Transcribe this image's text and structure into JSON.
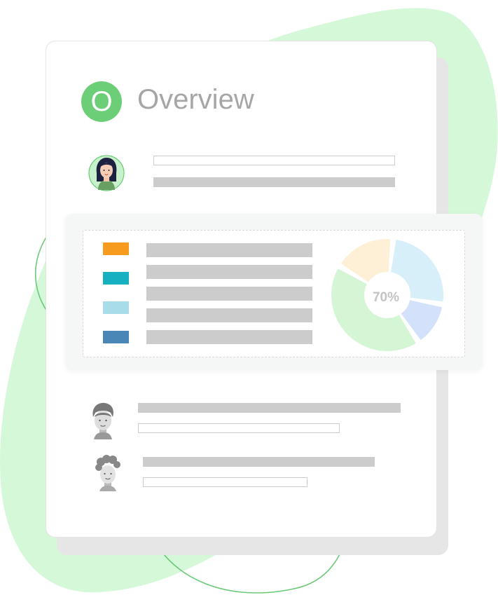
{
  "header": {
    "logo_letter": "O",
    "title": "Overview"
  },
  "chart_data": {
    "type": "pie",
    "center_label": "70%",
    "categories": [
      "orange",
      "teal",
      "light-blue",
      "steel-blue"
    ],
    "swatch_colors": [
      "#f79b1e",
      "#16b0c0",
      "#a8dce8",
      "#4a87b7"
    ],
    "slices": [
      {
        "color": "#d7eff8",
        "value": 26
      },
      {
        "color": "#d4e1fb",
        "value": 13
      },
      {
        "color": "#d4f6d5",
        "value": 43
      },
      {
        "color": "#fdf0d6",
        "value": 18
      }
    ]
  },
  "colors": {
    "accent": "#6ccf78",
    "blob": "#d4f8d8",
    "outline": "#6cc977",
    "placeholder": "#cccccc"
  },
  "icons": [
    "woman-avatar-icon",
    "man-avatar-icon",
    "curly-hair-avatar-icon"
  ]
}
